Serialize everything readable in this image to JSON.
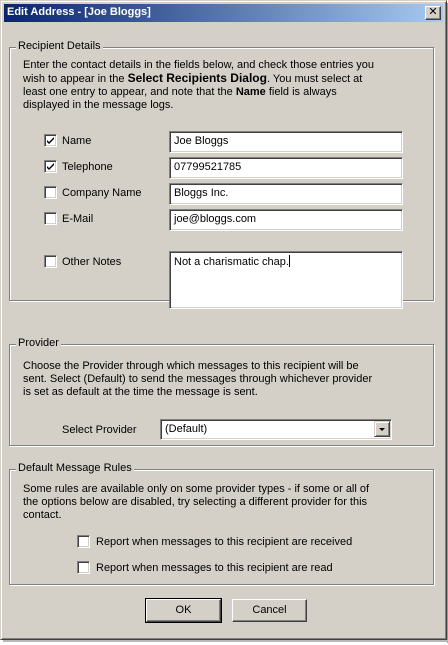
{
  "window": {
    "title": "Edit Address - [Joe Bloggs]",
    "close_glyph": "✕"
  },
  "recipient_details": {
    "legend": "Recipient Details",
    "intro": [
      {
        "text": "Enter the contact details in the fields below, and check those entries you",
        "bold": false
      },
      {
        "text": "wish to appear in the ",
        "bold": false
      },
      {
        "text": "Select Recipients Dialog",
        "bold": true
      },
      {
        "text": ". You must select at",
        "bold": false
      },
      {
        "text": "least one entry to appear, and note that the ",
        "bold": false
      },
      {
        "text": "Name",
        "bold": true
      },
      {
        "text": " field is always",
        "bold": false
      },
      {
        "text": "displayed in the message logs.",
        "bold": false
      }
    ],
    "fields": [
      {
        "label": "Name",
        "checked": true,
        "value": "Joe Bloggs"
      },
      {
        "label": "Telephone",
        "checked": true,
        "value": "07799521785"
      },
      {
        "label": "Company Name",
        "checked": false,
        "value": "Bloggs Inc."
      },
      {
        "label": "E-Mail",
        "checked": false,
        "value": "joe@bloggs.com"
      },
      {
        "label": "Other Notes",
        "checked": false,
        "value": "Not a charismatic chap."
      }
    ]
  },
  "provider": {
    "legend": "Provider",
    "description_lines": [
      "Choose the Provider through which messages to this recipient will be",
      "sent. Select (Default) to send the messages through whichever provider",
      "is set as default at the time the message is sent."
    ],
    "select_label": "Select Provider",
    "select_value": "(Default)"
  },
  "rules": {
    "legend": "Default Message Rules",
    "description_lines": [
      "Some rules are available only on some provider types - if some or all of",
      "the options below are disabled, try selecting a different provider for this",
      "contact."
    ],
    "options": [
      {
        "label": "Report when messages to this recipient are received",
        "checked": false
      },
      {
        "label": "Report when messages to this recipient are read",
        "checked": false
      }
    ]
  },
  "buttons": {
    "ok": "OK",
    "cancel": "Cancel"
  },
  "colors": {
    "face": "#d4d0c8",
    "title_start": "#0a246a",
    "title_end": "#a6caf0"
  }
}
